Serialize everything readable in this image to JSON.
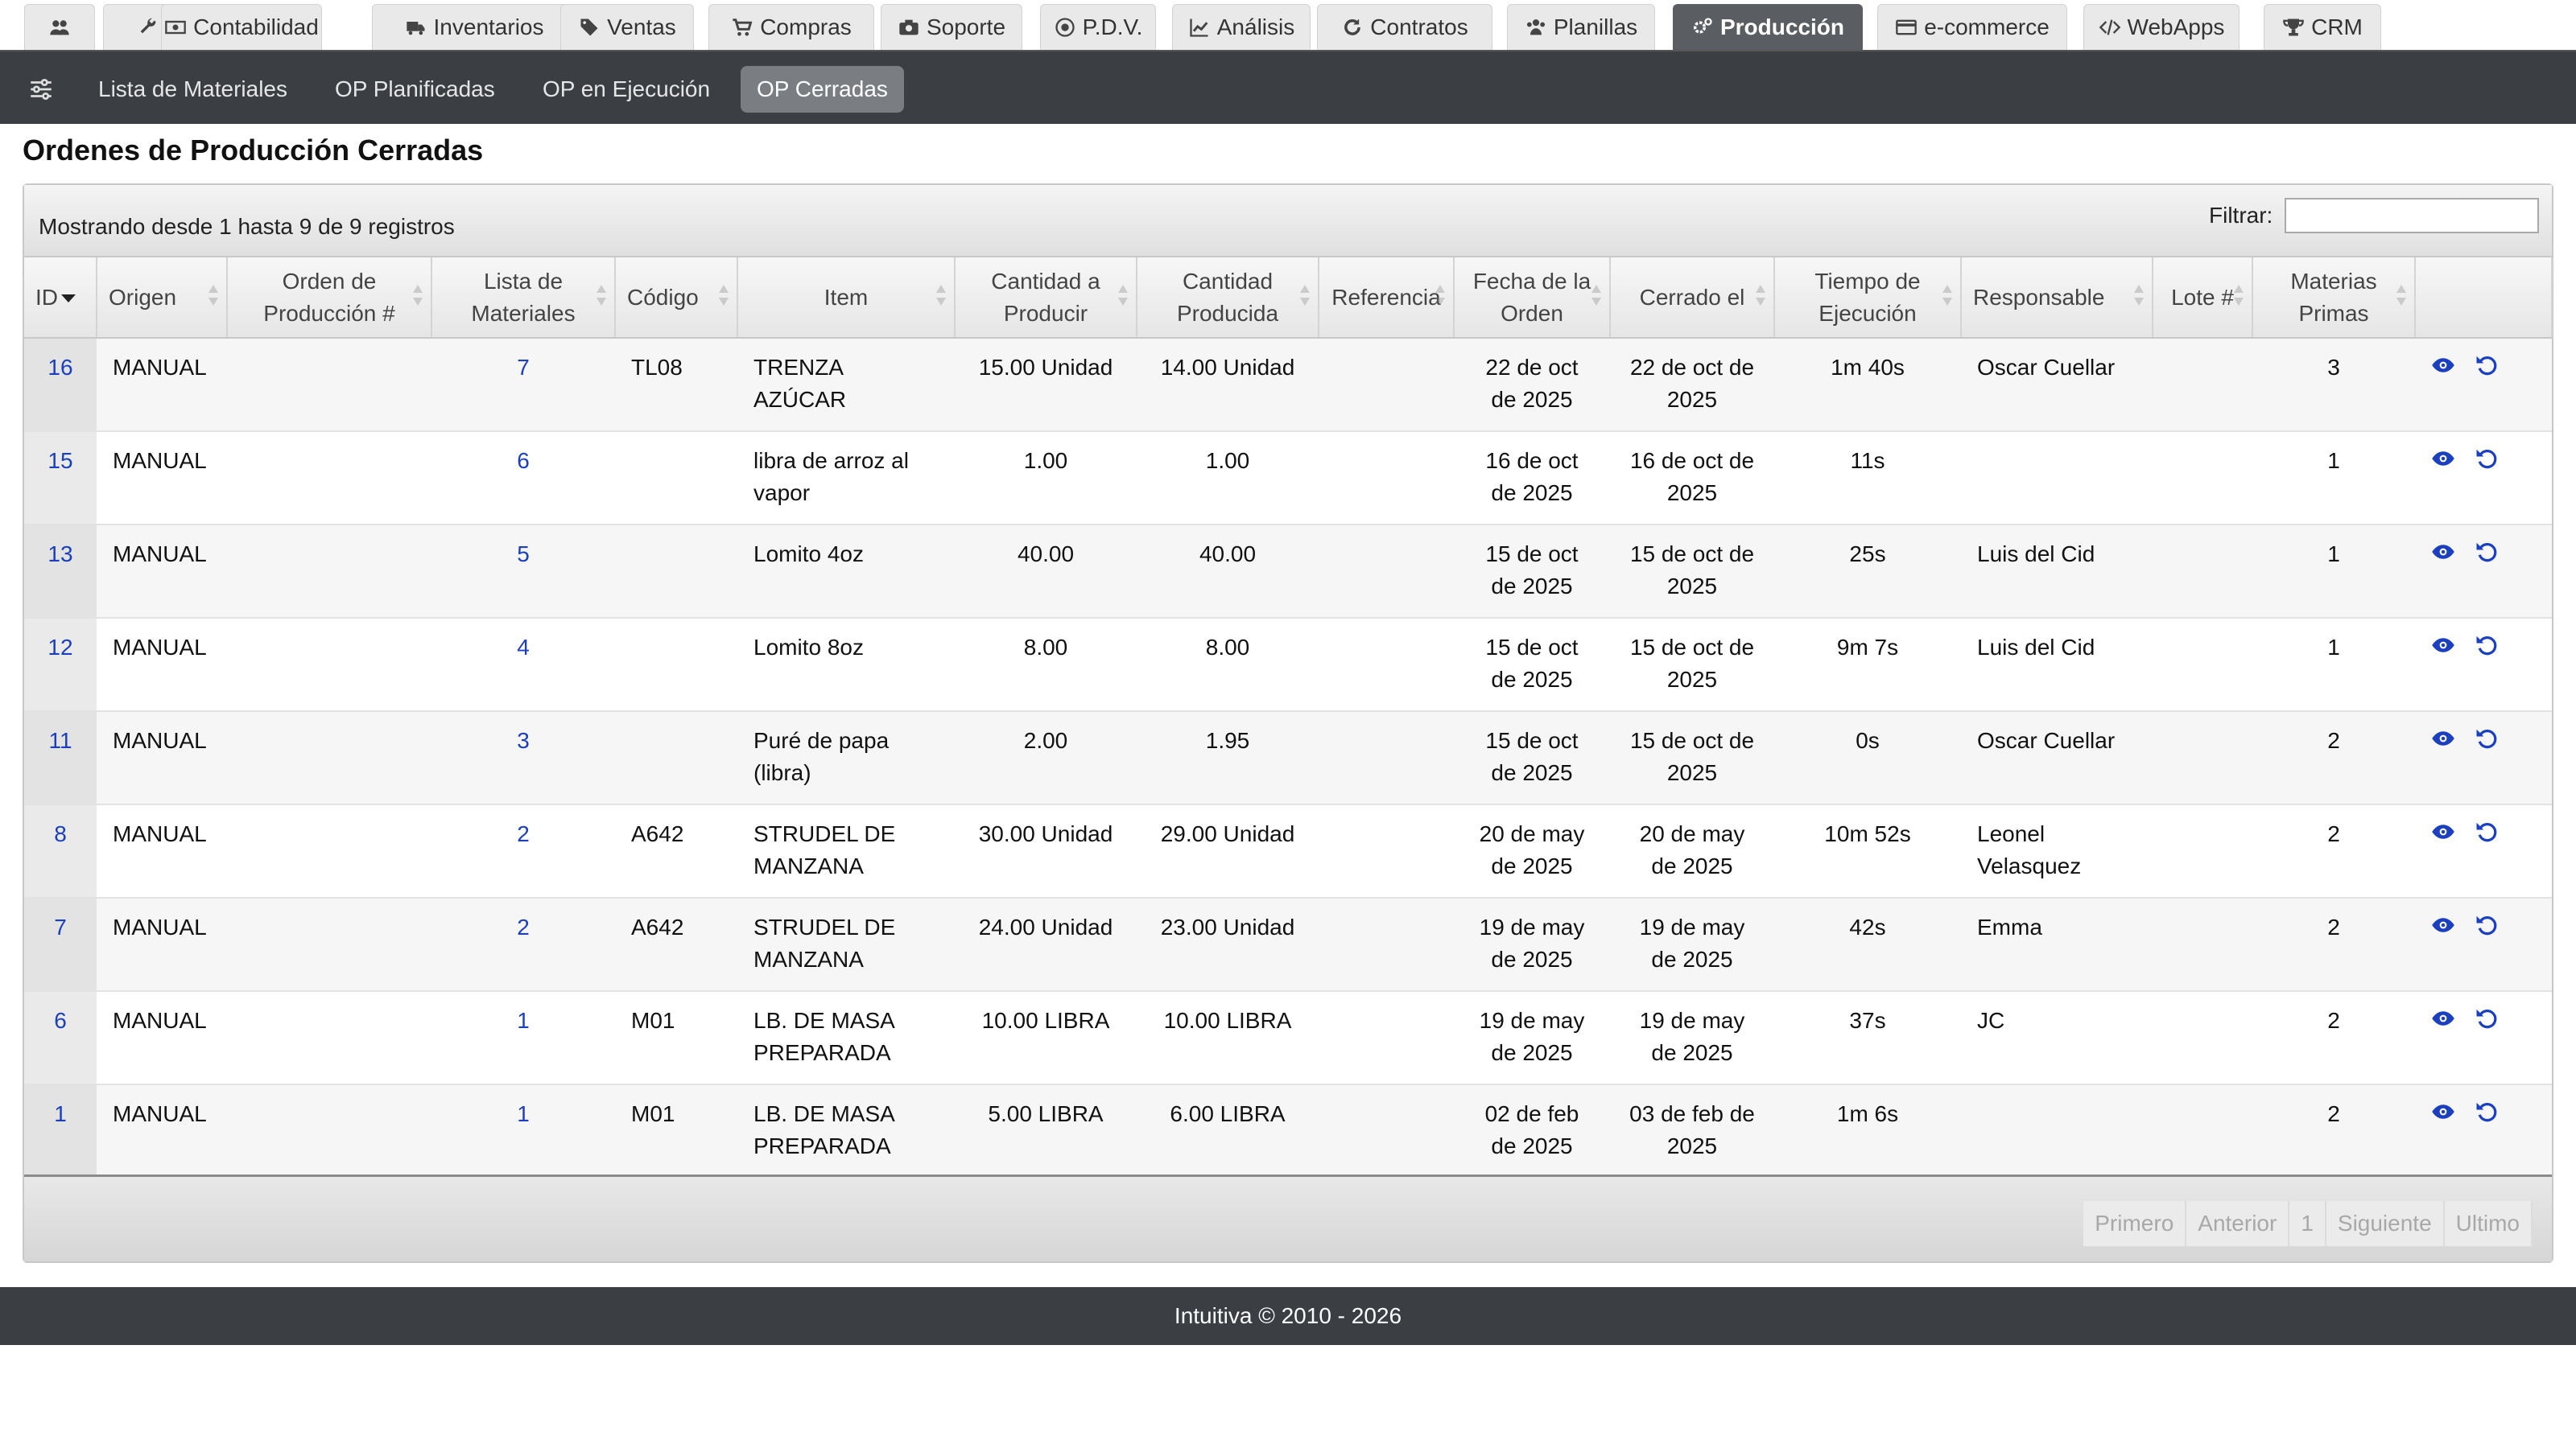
{
  "top_tabs": [
    {
      "label": "",
      "icon": "users-icon"
    },
    {
      "label": "",
      "icon": "wrench-icon"
    },
    {
      "label": "Contabilidad",
      "icon": "money-icon"
    },
    {
      "label": "Inventarios",
      "icon": "truck-icon"
    },
    {
      "label": "Ventas",
      "icon": "tags-icon"
    },
    {
      "label": "Compras",
      "icon": "cart-icon"
    },
    {
      "label": "Soporte",
      "icon": "camera-icon"
    },
    {
      "label": "P.D.V.",
      "icon": "pos-icon"
    },
    {
      "label": "Análisis",
      "icon": "chart-icon"
    },
    {
      "label": "Contratos",
      "icon": "refresh-icon"
    },
    {
      "label": "Planillas",
      "icon": "group-icon"
    },
    {
      "label": "Producción",
      "icon": "gears-icon",
      "active": true
    },
    {
      "label": "e-commerce",
      "icon": "card-icon"
    },
    {
      "label": "WebApps",
      "icon": "code-icon"
    },
    {
      "label": "CRM",
      "icon": "trophy-icon"
    }
  ],
  "subnav": {
    "items": [
      "Lista de Materiales",
      "OP Planificadas",
      "OP en Ejecución",
      "OP Cerradas"
    ],
    "active": "OP Cerradas"
  },
  "page_title": "Ordenes de Producción Cerradas",
  "table_info": "Mostrando desde 1 hasta 9 de 9 registros",
  "filter_label": "Filtrar:",
  "filter_value": "",
  "columns": [
    "ID",
    "Origen",
    "Orden de Producción #",
    "Lista de Materiales",
    "Código",
    "Item",
    "Cantidad a Producir",
    "Cantidad Producida",
    "Referencia",
    "Fecha de la Orden",
    "Cerrado el",
    "Tiempo de Ejecución",
    "Responsable",
    "Lote #",
    "Materias Primas",
    ""
  ],
  "rows": [
    {
      "id": "16",
      "origen": "MANUAL",
      "orden": "",
      "lista": "7",
      "codigo": "TL08",
      "item": "TRENZA AZÚCAR",
      "cant_prod": "15.00 Unidad",
      "cant_hecha": "14.00 Unidad",
      "ref": "",
      "fecha": "22 de oct de 2025",
      "cerrado": "22 de oct de 2025",
      "tiempo": "1m 40s",
      "resp": "Oscar Cuellar",
      "lote": "",
      "materias": "3"
    },
    {
      "id": "15",
      "origen": "MANUAL",
      "orden": "",
      "lista": "6",
      "codigo": "",
      "item": "libra de arroz al vapor",
      "cant_prod": "1.00",
      "cant_hecha": "1.00",
      "ref": "",
      "fecha": "16 de oct de 2025",
      "cerrado": "16 de oct de 2025",
      "tiempo": "11s",
      "resp": "",
      "lote": "",
      "materias": "1"
    },
    {
      "id": "13",
      "origen": "MANUAL",
      "orden": "",
      "lista": "5",
      "codigo": "",
      "item": "Lomito 4oz",
      "cant_prod": "40.00",
      "cant_hecha": "40.00",
      "ref": "",
      "fecha": "15 de oct de 2025",
      "cerrado": "15 de oct de 2025",
      "tiempo": "25s",
      "resp": "Luis del Cid",
      "lote": "",
      "materias": "1"
    },
    {
      "id": "12",
      "origen": "MANUAL",
      "orden": "",
      "lista": "4",
      "codigo": "",
      "item": "Lomito 8oz",
      "cant_prod": "8.00",
      "cant_hecha": "8.00",
      "ref": "",
      "fecha": "15 de oct de 2025",
      "cerrado": "15 de oct de 2025",
      "tiempo": "9m 7s",
      "resp": "Luis del Cid",
      "lote": "",
      "materias": "1"
    },
    {
      "id": "11",
      "origen": "MANUAL",
      "orden": "",
      "lista": "3",
      "codigo": "",
      "item": "Puré de papa (libra)",
      "cant_prod": "2.00",
      "cant_hecha": "1.95",
      "ref": "",
      "fecha": "15 de oct de 2025",
      "cerrado": "15 de oct de 2025",
      "tiempo": "0s",
      "resp": "Oscar Cuellar",
      "lote": "",
      "materias": "2"
    },
    {
      "id": "8",
      "origen": "MANUAL",
      "orden": "",
      "lista": "2",
      "codigo": "A642",
      "item": "STRUDEL DE MANZANA",
      "cant_prod": "30.00 Unidad",
      "cant_hecha": "29.00 Unidad",
      "ref": "",
      "fecha": "20 de may de 2025",
      "cerrado": "20 de may de 2025",
      "tiempo": "10m 52s",
      "resp": "Leonel Velasquez",
      "lote": "",
      "materias": "2"
    },
    {
      "id": "7",
      "origen": "MANUAL",
      "orden": "",
      "lista": "2",
      "codigo": "A642",
      "item": "STRUDEL DE MANZANA",
      "cant_prod": "24.00 Unidad",
      "cant_hecha": "23.00 Unidad",
      "ref": "",
      "fecha": "19 de may de 2025",
      "cerrado": "19 de may de 2025",
      "tiempo": "42s",
      "resp": "Emma",
      "lote": "",
      "materias": "2"
    },
    {
      "id": "6",
      "origen": "MANUAL",
      "orden": "",
      "lista": "1",
      "codigo": "M01",
      "item": "LB. DE MASA PREPARADA",
      "cant_prod": "10.00 LIBRA",
      "cant_hecha": "10.00 LIBRA",
      "ref": "",
      "fecha": "19 de may de 2025",
      "cerrado": "19 de may de 2025",
      "tiempo": "37s",
      "resp": "JC",
      "lote": "",
      "materias": "2"
    },
    {
      "id": "1",
      "origen": "MANUAL",
      "orden": "",
      "lista": "1",
      "codigo": "M01",
      "item": "LB. DE MASA PREPARADA",
      "cant_prod": "5.00 LIBRA",
      "cant_hecha": "6.00 LIBRA",
      "ref": "",
      "fecha": "02 de feb de 2025",
      "cerrado": "03 de feb de 2025",
      "tiempo": "1m 6s",
      "resp": "",
      "lote": "",
      "materias": "2"
    }
  ],
  "pager": [
    "Primero",
    "Anterior",
    "1",
    "Siguiente",
    "Ultimo"
  ],
  "footer": "Intuitiva © 2010 - 2026",
  "colors": {
    "link": "#1a3fbf",
    "nav_bg": "#3b3f44",
    "active_tab": "#5a5e63"
  }
}
